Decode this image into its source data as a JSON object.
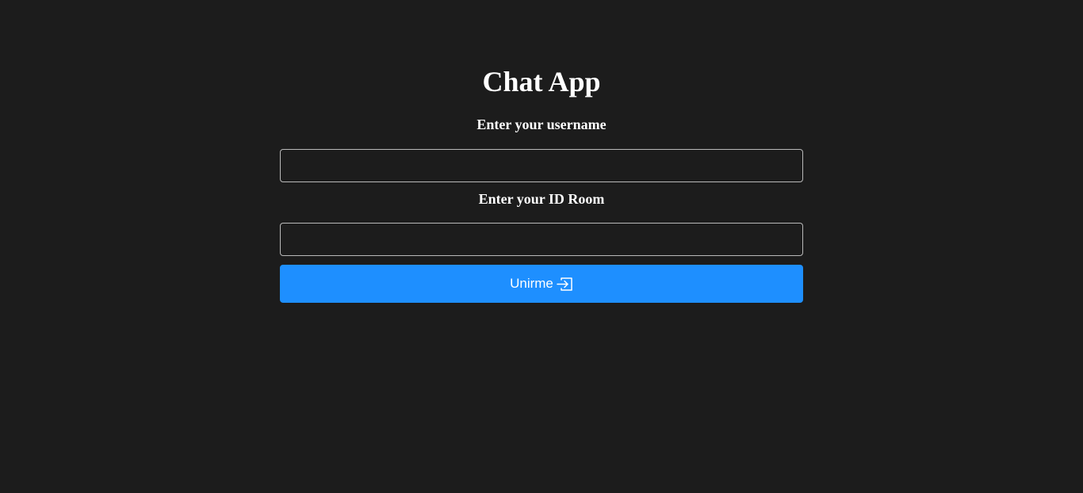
{
  "app": {
    "title": "Chat App"
  },
  "form": {
    "username_label": "Enter your username",
    "username_value": "",
    "username_placeholder": "",
    "room_label": "Enter your ID Room",
    "room_value": "",
    "room_placeholder": "",
    "join_label": "Unirme",
    "join_icon": "sign-in-icon"
  },
  "colors": {
    "background": "#1c1c1c",
    "accent": "#1e8fff",
    "text": "#ffffff",
    "input_border": "#b9b9b9"
  }
}
